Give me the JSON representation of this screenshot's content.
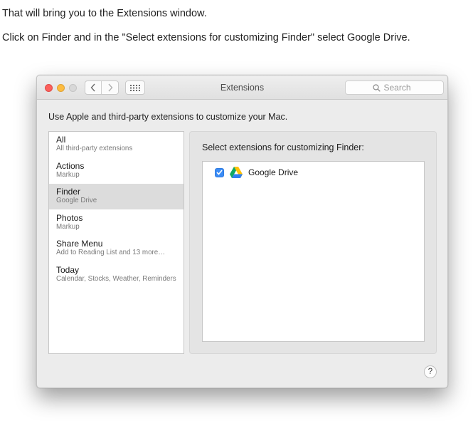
{
  "document": {
    "line1": "That will bring you to the Extensions window.",
    "line2": "Click on Finder and in the \"Select extensions for customizing Finder\" select Google Drive."
  },
  "window": {
    "title": "Extensions",
    "search_placeholder": "Search",
    "description": "Use Apple and third-party extensions to customize your Mac.",
    "help_label": "?"
  },
  "sidebar": {
    "selected_index": 2,
    "items": [
      {
        "title": "All",
        "subtitle": "All third-party extensions"
      },
      {
        "title": "Actions",
        "subtitle": "Markup"
      },
      {
        "title": "Finder",
        "subtitle": "Google Drive"
      },
      {
        "title": "Photos",
        "subtitle": "Markup"
      },
      {
        "title": "Share Menu",
        "subtitle": "Add to Reading List and 13 more…"
      },
      {
        "title": "Today",
        "subtitle": "Calendar, Stocks, Weather, Reminders"
      }
    ]
  },
  "panel": {
    "heading": "Select extensions for customizing Finder:",
    "extensions": [
      {
        "name": "Google Drive",
        "checked": true,
        "icon": "google-drive-icon"
      }
    ]
  },
  "icons": {
    "back": "chevron-left-icon",
    "forward": "chevron-right-icon",
    "grid": "grid-icon",
    "search": "search-icon",
    "help": "question-mark-icon"
  },
  "colors": {
    "close": "#fc605c",
    "minimize": "#fdbc40",
    "zoom_disabled": "#d8d8d8",
    "checkbox": "#3b8cf5",
    "selected_row": "#dcdcdc"
  }
}
